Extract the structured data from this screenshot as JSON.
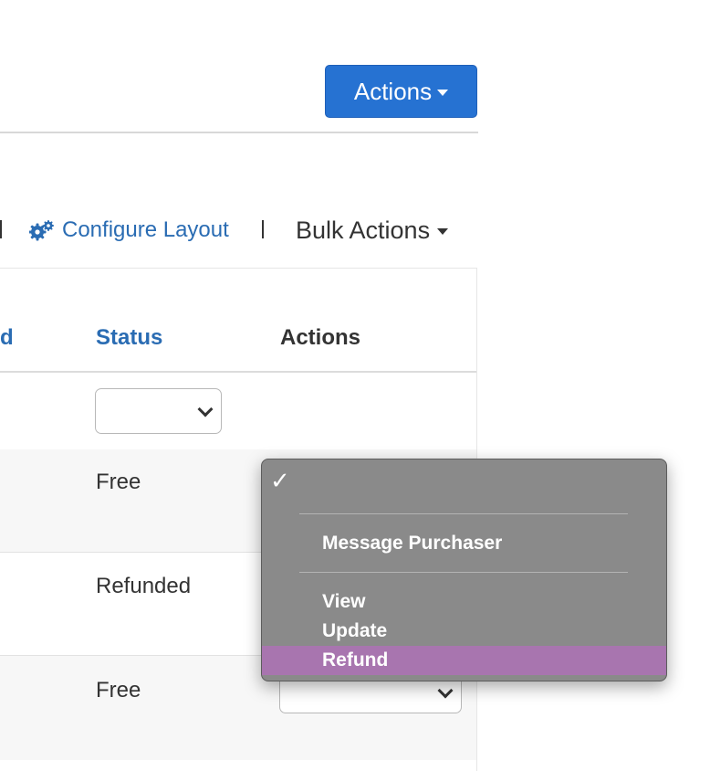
{
  "header": {
    "actions_button_label": "Actions"
  },
  "toolbar": {
    "configure_layout_label": "Configure Layout",
    "bulk_actions_label": "Bulk Actions"
  },
  "table": {
    "columns": {
      "partial_header": "d",
      "status": "Status",
      "actions": "Actions"
    },
    "status_filter_value": "",
    "rows": [
      {
        "status": "Free"
      },
      {
        "status": "Refunded"
      },
      {
        "status": "Free"
      }
    ]
  },
  "action_menu": {
    "selected_value": "",
    "items": [
      "Message Purchaser",
      "View",
      "Update",
      "Refund"
    ],
    "highlighted_item": "Refund"
  },
  "colors": {
    "primary_button": "#2672d2",
    "link": "#2a6cb3",
    "menu_background": "#8a8a8a",
    "menu_highlight": "#a875af"
  },
  "icons": {
    "configure_layout": "cogs-icon",
    "dropdown_caret": "caret-down-icon",
    "select_chevron": "chevron-down-icon",
    "menu_check": "checkmark-icon"
  }
}
